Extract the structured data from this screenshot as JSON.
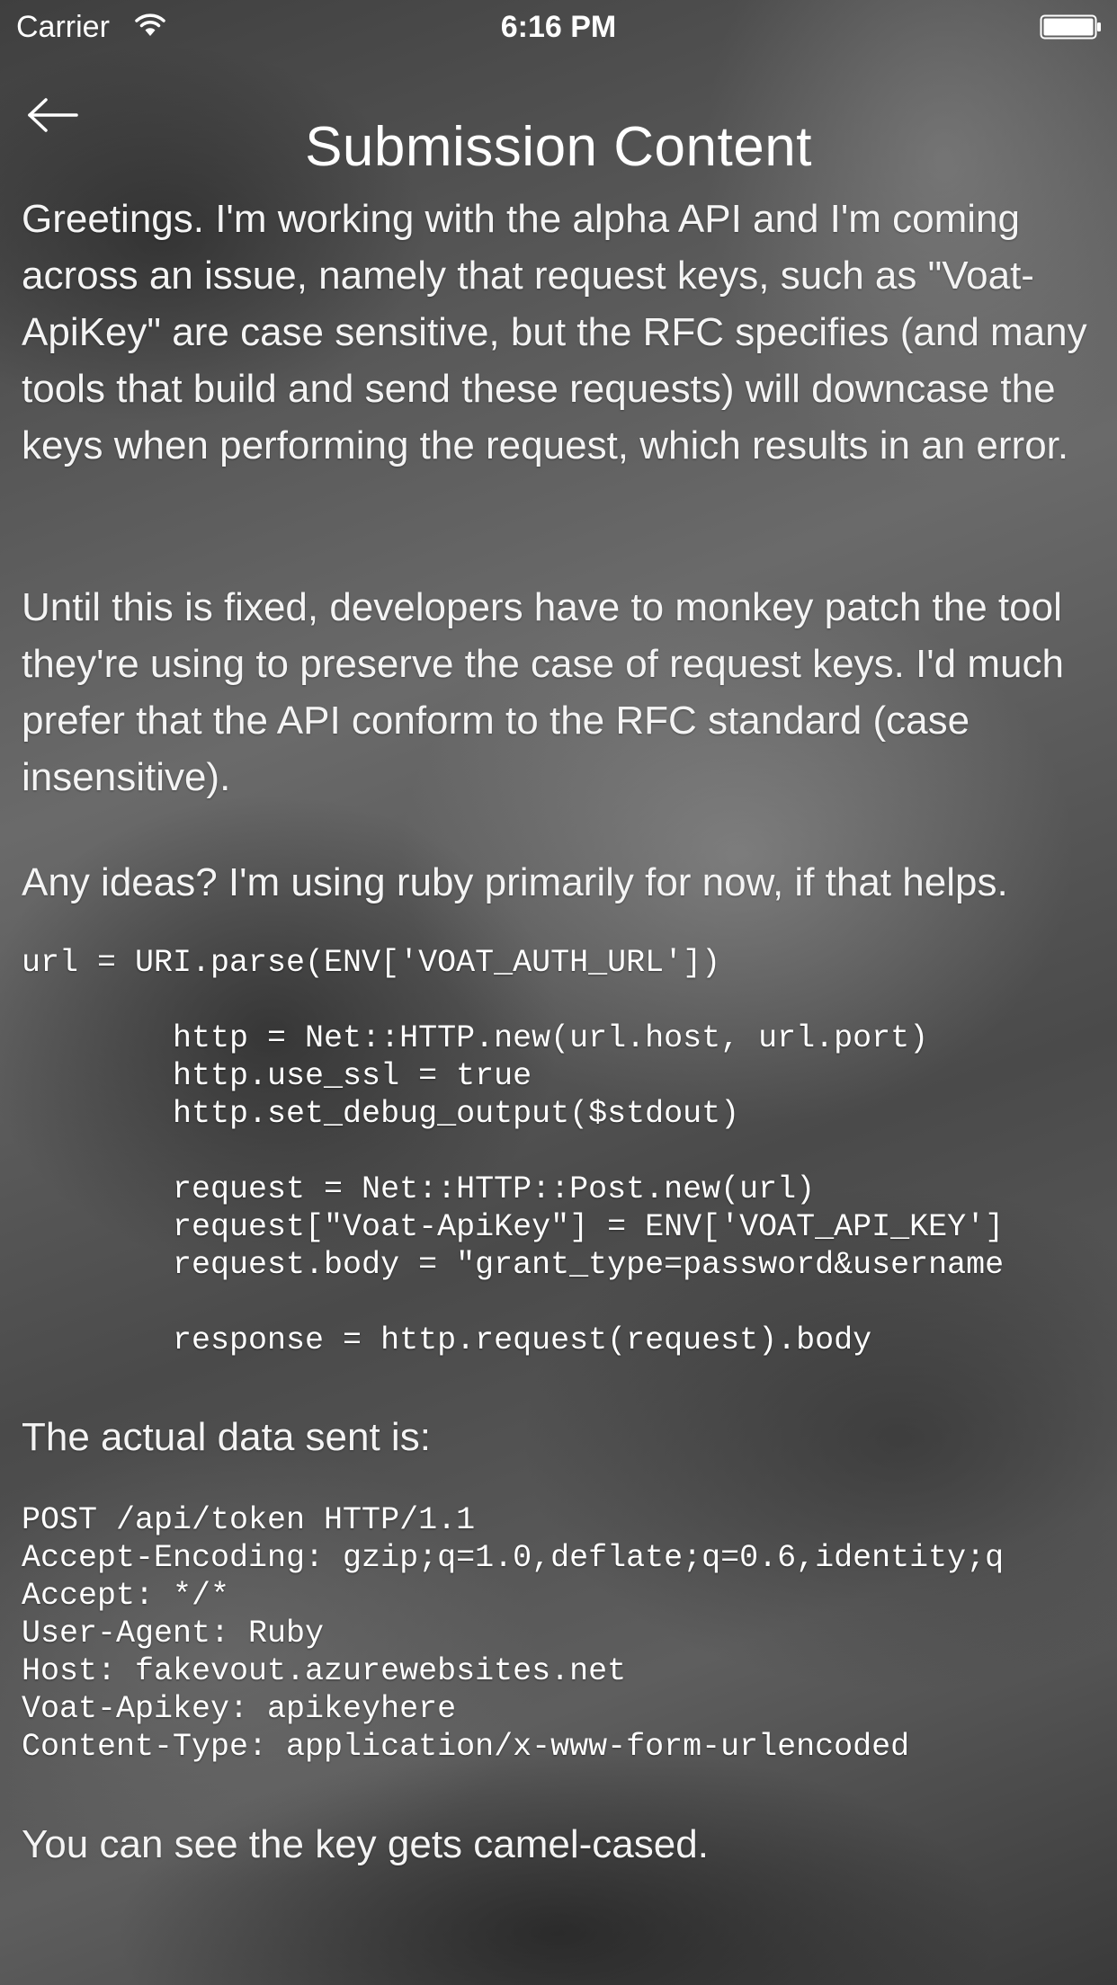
{
  "status_bar": {
    "carrier": "Carrier",
    "time": "6:16 PM",
    "icons": [
      "wifi-icon",
      "battery-icon"
    ]
  },
  "nav": {
    "back_icon": "left-arrow-icon",
    "title": "Submission Content"
  },
  "content": {
    "paragraph_1": "Greetings. I'm working with the alpha API and I'm coming across an issue, namely that request keys, such as \"Voat-ApiKey\" are case sensitive, but the RFC specifies (and many tools that build and send these requests) will downcase the keys when performing the request, which results in an error.",
    "paragraph_2": "Until this is fixed, developers have to monkey patch the tool they're using to preserve the case of request keys. I'd much prefer that the API conform to the RFC standard (case insensitive).",
    "paragraph_3": "Any ideas? I'm using ruby primarily for now, if that helps.",
    "code_block_1": "url = URI.parse(ENV['VOAT_AUTH_URL'])\n\n        http = Net::HTTP.new(url.host, url.port)\n        http.use_ssl = true\n        http.set_debug_output($stdout)\n\n        request = Net::HTTP::Post.new(url)\n        request[\"Voat-ApiKey\"] = ENV['VOAT_API_KEY']\n        request.body = \"grant_type=password&username\n\n        response = http.request(request).body",
    "paragraph_4": "The actual data sent is:",
    "code_block_2": "POST /api/token HTTP/1.1\nAccept-Encoding: gzip;q=1.0,deflate;q=0.6,identity;q\nAccept: */*\nUser-Agent: Ruby\nHost: fakevout.azurewebsites.net\nVoat-Apikey: apikeyhere\nContent-Type: application/x-www-form-urlencoded",
    "paragraph_5": "You can see the key gets camel-cased."
  }
}
